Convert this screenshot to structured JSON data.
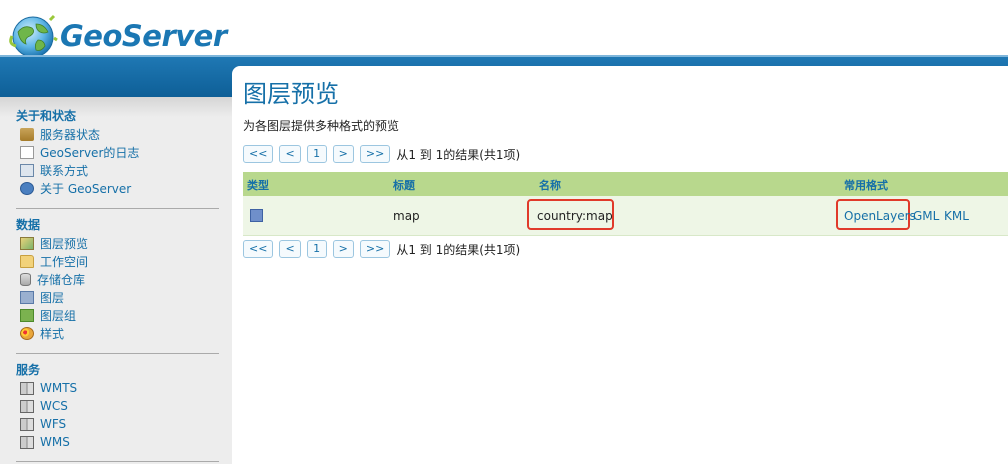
{
  "app": {
    "name": "GeoServer"
  },
  "sidebar": {
    "sections": [
      {
        "title": "关于和状态",
        "items": [
          {
            "label": "服务器状态",
            "icon": "server-status-icon"
          },
          {
            "label": "GeoServer的日志",
            "icon": "log-document-icon"
          },
          {
            "label": "联系方式",
            "icon": "contact-card-icon"
          },
          {
            "label": "关于 GeoServer",
            "icon": "info-icon"
          }
        ]
      },
      {
        "title": "数据",
        "items": [
          {
            "label": "图层预览",
            "icon": "map-preview-icon"
          },
          {
            "label": "工作空间",
            "icon": "folder-icon"
          },
          {
            "label": "存储仓库",
            "icon": "database-icon"
          },
          {
            "label": "图层",
            "icon": "layer-icon"
          },
          {
            "label": "图层组",
            "icon": "layer-group-icon"
          },
          {
            "label": "样式",
            "icon": "style-palette-icon"
          }
        ]
      },
      {
        "title": "服务",
        "items": [
          {
            "label": "WMTS",
            "icon": "service-icon"
          },
          {
            "label": "WCS",
            "icon": "service-icon"
          },
          {
            "label": "WFS",
            "icon": "service-icon"
          },
          {
            "label": "WMS",
            "icon": "service-icon"
          }
        ]
      }
    ]
  },
  "main": {
    "title": "图层预览",
    "description": "为各图层提供多种格式的预览",
    "pager": {
      "first": "<<",
      "prev": "<",
      "page": "1",
      "next": ">",
      "last": ">>",
      "summary": "从1 到 1的结果(共1项)"
    },
    "table": {
      "headers": {
        "type": "类型",
        "title": "标题",
        "name": "名称",
        "formats": "常用格式"
      },
      "rows": [
        {
          "title": "map",
          "name": "country:map",
          "formats": [
            "OpenLayers",
            "GML",
            "KML"
          ]
        }
      ]
    }
  },
  "colors": {
    "brand": "#1670a8",
    "header_band": "#1f78b4",
    "table_header": "#b8d88d",
    "table_row": "#eef6e6",
    "highlight": "#e03a2a"
  }
}
